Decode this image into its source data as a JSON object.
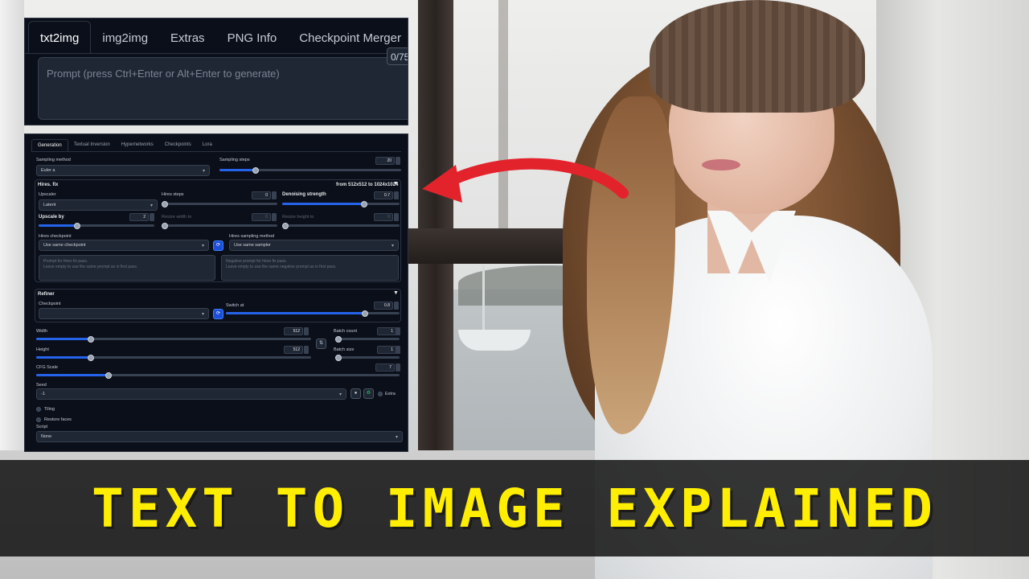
{
  "tabs": [
    "txt2img",
    "img2img",
    "Extras",
    "PNG Info",
    "Checkpoint Merger"
  ],
  "prompt": {
    "placeholder": "Prompt (press Ctrl+Enter or Alt+Enter to generate)",
    "token_counter": "0/75"
  },
  "subtabs": [
    "Generation",
    "Textual Inversion",
    "Hypernetworks",
    "Checkpoints",
    "Lora"
  ],
  "sampling": {
    "method_label": "Sampling method",
    "method_value": "Euler a",
    "steps_label": "Sampling steps",
    "steps_value": "20",
    "steps_level": 0.2
  },
  "hires": {
    "title": "Hires. fix",
    "size_info": "from 512x512 to 1024x1024",
    "upscaler_label": "Upscaler",
    "upscaler_value": "Latent",
    "steps_label": "Hires steps",
    "steps_value": "0",
    "denoise_label": "Denoising strength",
    "denoise_value": "0.7",
    "denoise_level": 0.7,
    "upscale_by_label": "Upscale by",
    "upscale_by_value": "2",
    "upscale_by_level": 0.33,
    "resize_w_label": "Resize width to",
    "resize_w_value": "0",
    "resize_h_label": "Resize height to",
    "resize_h_value": "0",
    "checkpoint_label": "Hires checkpoint",
    "checkpoint_value": "Use same checkpoint",
    "sampler_label": "Hires sampling method",
    "sampler_value": "Use same sampler",
    "prompt_placeholder_1": "Prompt for hires fix pass.",
    "prompt_placeholder_2": "Leave empty to use the same prompt as in first pass.",
    "neg_placeholder_1": "Negative prompt for hires fix pass.",
    "neg_placeholder_2": "Leave empty to use the same negative prompt as in first pass."
  },
  "refiner": {
    "title": "Refiner",
    "checkpoint_label": "Checkpoint",
    "checkpoint_value": "",
    "switch_label": "Switch at",
    "switch_value": "0.8",
    "switch_level": 0.8
  },
  "size": {
    "width_label": "Width",
    "width_value": "512",
    "width_level": 0.2,
    "height_label": "Height",
    "height_value": "512",
    "height_level": 0.2,
    "swap_icon": "swap-icon"
  },
  "batch": {
    "count_label": "Batch count",
    "count_value": "1",
    "size_label": "Batch size",
    "size_value": "1"
  },
  "cfg": {
    "label": "CFG Scale",
    "value": "7",
    "level": 0.2
  },
  "seed": {
    "label": "Seed",
    "value": "-1",
    "extra_label": "Extra"
  },
  "options": {
    "tiling": "Tiling",
    "restore_faces": "Restore faces"
  },
  "script": {
    "label": "Script",
    "value": "None"
  },
  "banner": {
    "text": "TEXT TO IMAGE EXPLAINED"
  },
  "colors": {
    "accent": "#2563eb",
    "banner_text": "#ffee00",
    "arrow": "#e3232c",
    "panel_bg": "#0b0f19"
  }
}
